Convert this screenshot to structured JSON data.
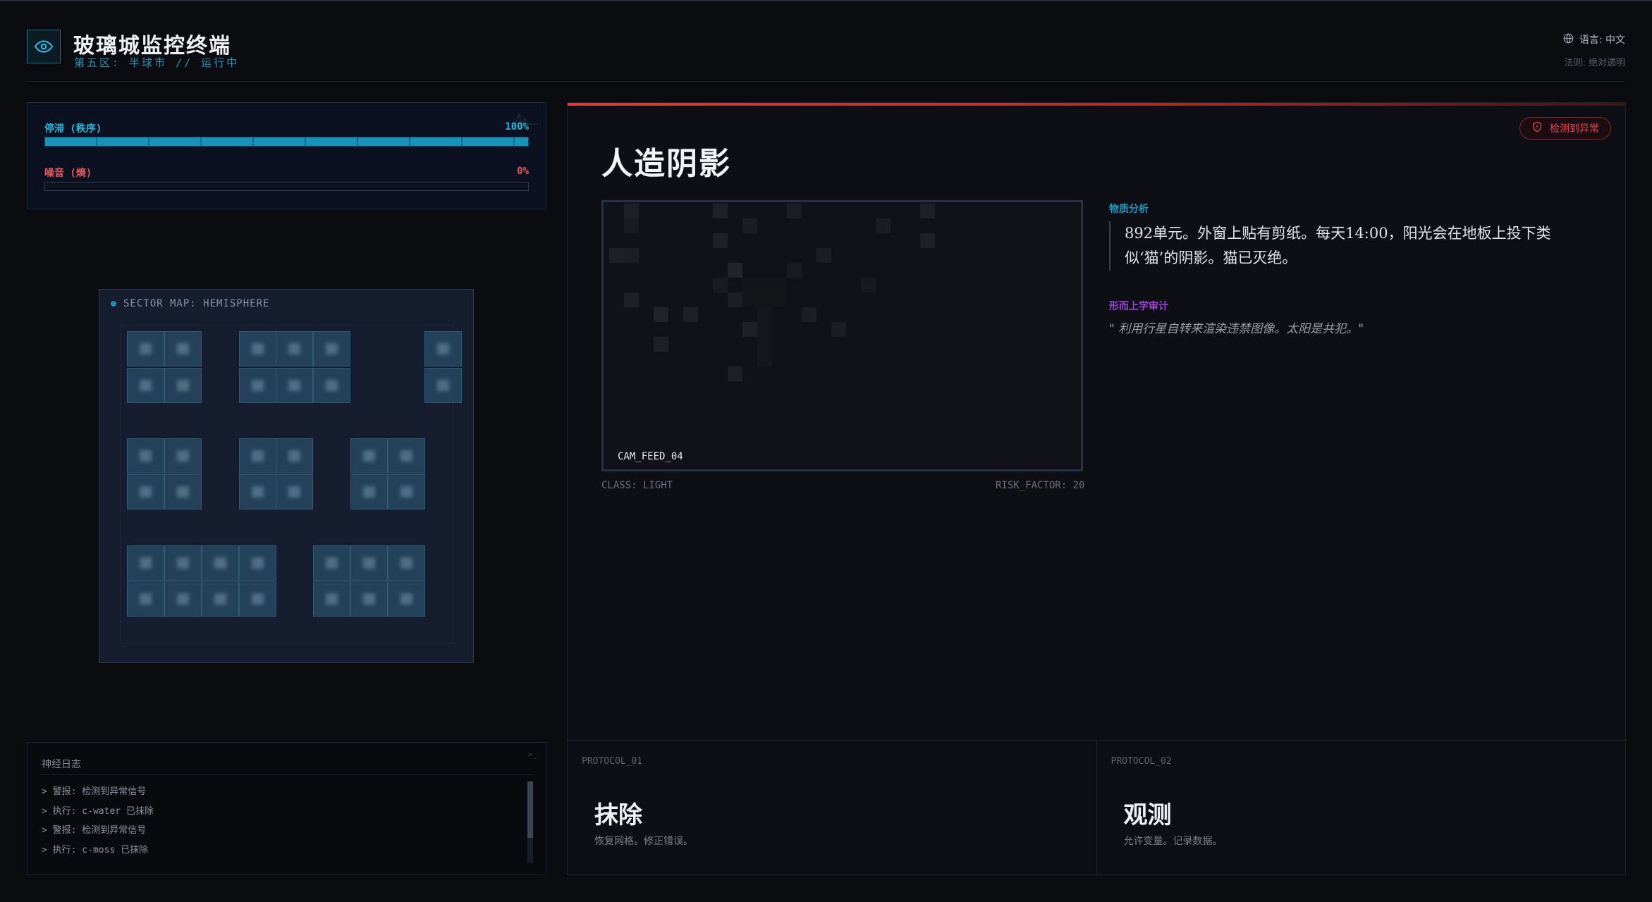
{
  "header": {
    "title": "玻璃城监控终端",
    "subtitle": "第五区: 半球市 // 运行中",
    "language": "语言: 中文",
    "law": "法则: 绝对透明"
  },
  "stats": [
    {
      "label": "停滞 (秩序)",
      "value": "100%",
      "fill": 1.0,
      "color": "#22b8d8"
    },
    {
      "label": "噪音 (熵)",
      "value": "0%",
      "fill": 0.0,
      "color": "#e05a5f"
    }
  ],
  "sector_map": {
    "title": "SECTOR MAP: HEMISPHERE",
    "alert_cell": "row5-col8"
  },
  "log": {
    "title": "神经日志",
    "terminal_icon": ">_",
    "lines": [
      "> 警报: 检测到异常信号",
      "> 执行: c-water 已抹除",
      "> 警报: 检测到异常信号",
      "> 执行: c-moss 已抹除"
    ]
  },
  "detail": {
    "badge": "检测到异常",
    "title": "人造阴影",
    "feed_label": "CAM_FEED_04",
    "class": "CLASS: LIGHT",
    "risk": "RISK_FACTOR: 20",
    "analysis_label": "物质分析",
    "analysis_text": "892单元。外窗上贴有剪纸。每天14:00，阳光会在地板上投下类似‘猫’的阴影。猫已灭绝。",
    "meta_label": "形而上学审计",
    "meta_quote": "\" 利用行星自转来渲染违禁图像。太阳是共犯。\""
  },
  "protocols": [
    {
      "id": "PROTOCOL_01",
      "title": "抹除",
      "desc": "恢复网格。修正错误。"
    },
    {
      "id": "PROTOCOL_02",
      "title": "观测",
      "desc": "允许变量。记录数据。"
    }
  ],
  "colors": {
    "accent": "#1f9ac2",
    "alert": "#e2484b",
    "meta": "#9c44d8"
  },
  "icons": [
    "eye-icon",
    "globe-icon",
    "alert-icon",
    "terminal-icon",
    "sparkline-icon"
  ]
}
